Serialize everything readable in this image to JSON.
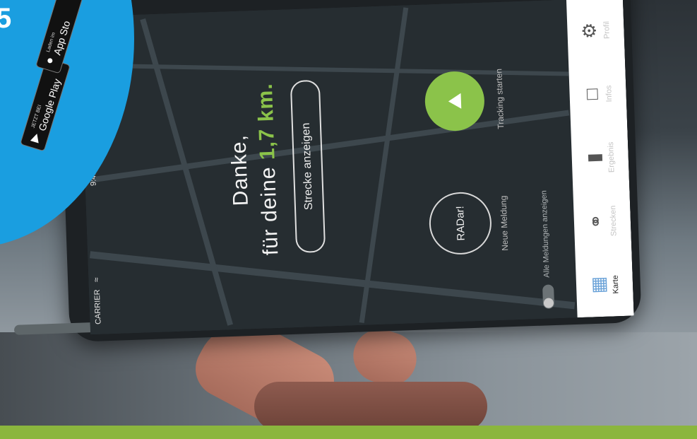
{
  "status": {
    "carrier": "CARRIER",
    "wifi_icon": "wifi-icon",
    "time": "9:41"
  },
  "main": {
    "thanks_line1": "Danke,",
    "thanks_line2_prefix": "für deine ",
    "distance": "1,7 km.",
    "route_button": "Strecke anzeigen",
    "radar_button": "RADar!",
    "radar_label": "Neue Meldung",
    "track_label": "Tracking starten",
    "toggle_label": "Alle Meldungen anzeigen"
  },
  "tabbar": {
    "items": [
      {
        "label": "Karte",
        "icon": "map-icon",
        "active": true
      },
      {
        "label": "Strecken",
        "icon": "bicycle-icon",
        "active": false
      },
      {
        "label": "Ergebnis",
        "icon": "bar-chart-icon",
        "active": false
      },
      {
        "label": "Infos",
        "icon": "book-icon",
        "active": false
      },
      {
        "label": "Profil",
        "icon": "gear-icon",
        "active": false
      }
    ]
  },
  "badge": {
    "headline": "5",
    "google_small": "JETZT BEI",
    "google_big": "Google Play",
    "apple_small": "Laden im",
    "apple_big": "App Sto"
  },
  "colors": {
    "accent_green": "#8bc34a",
    "badge_blue": "#1a9ee0",
    "tab_active": "#6aa2d8"
  }
}
